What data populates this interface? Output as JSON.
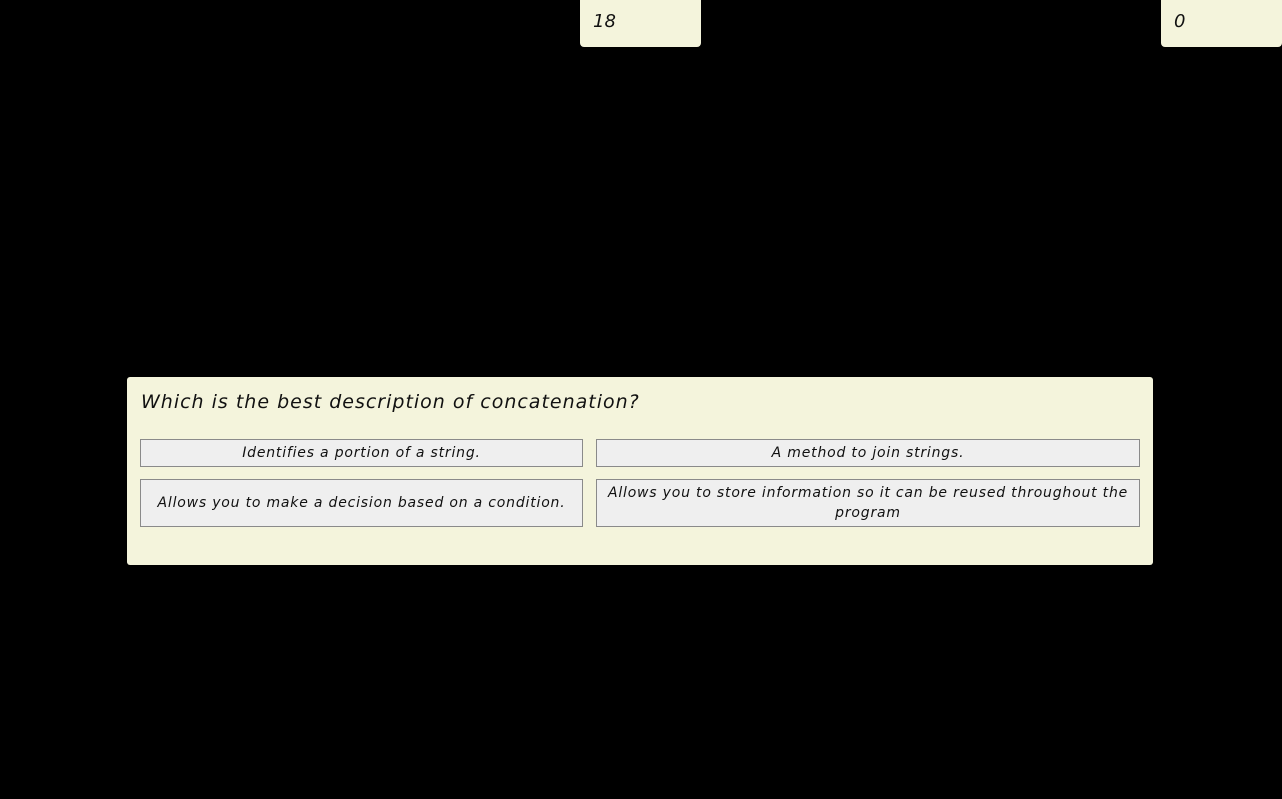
{
  "hud": {
    "timer": "18",
    "score": "0"
  },
  "quiz": {
    "question": "Which is the best description of concatenation?",
    "answers": [
      "Identifies a portion of a string.",
      "A method to join strings.",
      "Allows you to make a decision based on a condition.",
      "Allows you to store information so it can be reused throughout the program"
    ]
  },
  "colors": {
    "background": "#000000",
    "panel": "#f4f4dc",
    "button": "#efefef",
    "button_border": "#8a8a8a",
    "text": "#111111"
  }
}
